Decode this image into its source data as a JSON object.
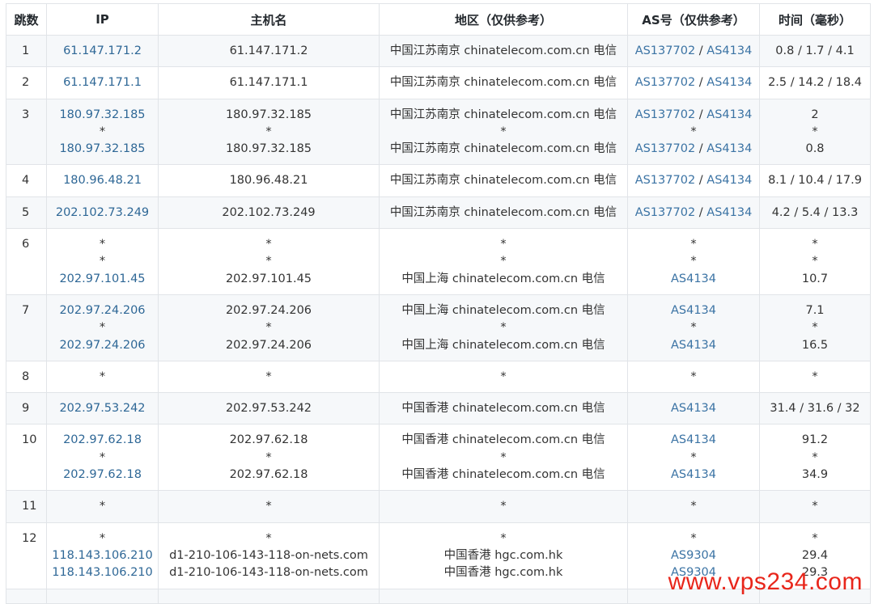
{
  "headers": {
    "hop": "跳数",
    "ip": "IP",
    "hostname": "主机名",
    "region": "地区（仅供参考）",
    "as": "AS号（仅供参考）",
    "time": "时间（毫秒）"
  },
  "rows": [
    {
      "hop": "1",
      "ip": [
        "61.147.171.2"
      ],
      "hostname": [
        "61.147.171.2"
      ],
      "region": [
        "中国江苏南京 chinatelecom.com.cn 电信"
      ],
      "as": [
        [
          "AS137702",
          "AS4134"
        ]
      ],
      "time": [
        "0.8 / 1.7 / 4.1"
      ]
    },
    {
      "hop": "2",
      "ip": [
        "61.147.171.1"
      ],
      "hostname": [
        "61.147.171.1"
      ],
      "region": [
        "中国江苏南京 chinatelecom.com.cn 电信"
      ],
      "as": [
        [
          "AS137702",
          "AS4134"
        ]
      ],
      "time": [
        "2.5 / 14.2 / 18.4"
      ]
    },
    {
      "hop": "3",
      "ip": [
        "180.97.32.185",
        "*",
        "180.97.32.185"
      ],
      "hostname": [
        "180.97.32.185",
        "*",
        "180.97.32.185"
      ],
      "region": [
        "中国江苏南京 chinatelecom.com.cn 电信",
        "*",
        "中国江苏南京 chinatelecom.com.cn 电信"
      ],
      "as": [
        [
          "AS137702",
          "AS4134"
        ],
        "*",
        [
          "AS137702",
          "AS4134"
        ]
      ],
      "time": [
        "2",
        "*",
        "0.8"
      ]
    },
    {
      "hop": "4",
      "ip": [
        "180.96.48.21"
      ],
      "hostname": [
        "180.96.48.21"
      ],
      "region": [
        "中国江苏南京 chinatelecom.com.cn 电信"
      ],
      "as": [
        [
          "AS137702",
          "AS4134"
        ]
      ],
      "time": [
        "8.1 / 10.4 / 17.9"
      ]
    },
    {
      "hop": "5",
      "ip": [
        "202.102.73.249"
      ],
      "hostname": [
        "202.102.73.249"
      ],
      "region": [
        "中国江苏南京 chinatelecom.com.cn 电信"
      ],
      "as": [
        [
          "AS137702",
          "AS4134"
        ]
      ],
      "time": [
        "4.2 / 5.4 / 13.3"
      ]
    },
    {
      "hop": "6",
      "ip": [
        "*",
        "*",
        "202.97.101.45"
      ],
      "hostname": [
        "*",
        "*",
        "202.97.101.45"
      ],
      "region": [
        "*",
        "*",
        "中国上海 chinatelecom.com.cn 电信"
      ],
      "as": [
        "*",
        "*",
        "AS4134"
      ],
      "time": [
        "*",
        "*",
        "10.7"
      ]
    },
    {
      "hop": "7",
      "ip": [
        "202.97.24.206",
        "*",
        "202.97.24.206"
      ],
      "hostname": [
        "202.97.24.206",
        "*",
        "202.97.24.206"
      ],
      "region": [
        "中国上海 chinatelecom.com.cn 电信",
        "*",
        "中国上海 chinatelecom.com.cn 电信"
      ],
      "as": [
        "AS4134",
        "*",
        "AS4134"
      ],
      "time": [
        "7.1",
        "*",
        "16.5"
      ]
    },
    {
      "hop": "8",
      "ip": [
        "*"
      ],
      "hostname": [
        "*"
      ],
      "region": [
        "*"
      ],
      "as": [
        "*"
      ],
      "time": [
        "*"
      ]
    },
    {
      "hop": "9",
      "ip": [
        "202.97.53.242"
      ],
      "hostname": [
        "202.97.53.242"
      ],
      "region": [
        "中国香港 chinatelecom.com.cn 电信"
      ],
      "as": [
        "AS4134"
      ],
      "time": [
        "31.4 / 31.6 / 32"
      ]
    },
    {
      "hop": "10",
      "ip": [
        "202.97.62.18",
        "*",
        "202.97.62.18"
      ],
      "hostname": [
        "202.97.62.18",
        "*",
        "202.97.62.18"
      ],
      "region": [
        "中国香港 chinatelecom.com.cn 电信",
        "*",
        "中国香港 chinatelecom.com.cn 电信"
      ],
      "as": [
        "AS4134",
        "*",
        "AS4134"
      ],
      "time": [
        "91.2",
        "*",
        "34.9"
      ]
    },
    {
      "hop": "11",
      "ip": [
        "*"
      ],
      "hostname": [
        "*"
      ],
      "region": [
        "*"
      ],
      "as": [
        "*"
      ],
      "time": [
        "*"
      ]
    },
    {
      "hop": "12",
      "ip": [
        "*",
        "118.143.106.210",
        "118.143.106.210"
      ],
      "hostname": [
        "*",
        "d1-210-106-143-118-on-nets.com",
        "d1-210-106-143-118-on-nets.com"
      ],
      "region": [
        "*",
        "中国香港 hgc.com.hk",
        "中国香港 hgc.com.hk"
      ],
      "as": [
        "*",
        "AS9304",
        "AS9304"
      ],
      "time": [
        "*",
        "29.4",
        "29.3"
      ]
    },
    {
      "hop": "",
      "ip": [
        ""
      ],
      "hostname": [
        ""
      ],
      "region": [
        ""
      ],
      "as": [
        ""
      ],
      "time": [
        ""
      ]
    }
  ],
  "watermark": "www.vps234.com",
  "colors": {
    "link": "#2e6796",
    "as_link": "#3b73a4",
    "border": "#e1e4e8",
    "stripe": "#f6f8fa",
    "watermark": "#e8261b"
  }
}
